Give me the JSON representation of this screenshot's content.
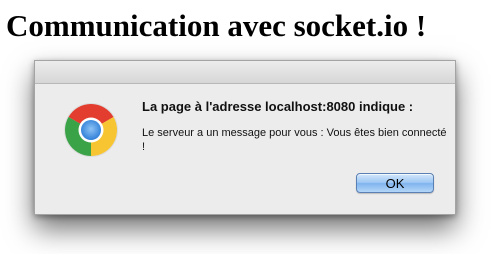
{
  "page": {
    "heading": "Communication avec socket.io !"
  },
  "dialog": {
    "icon": "chrome-icon",
    "title": "La page à l'adresse localhost:8080 indique :",
    "message": "Le serveur a un message pour vous : Vous êtes bien connecté !",
    "ok_label": "OK",
    "ok_button_color": "#9cc7f3"
  }
}
